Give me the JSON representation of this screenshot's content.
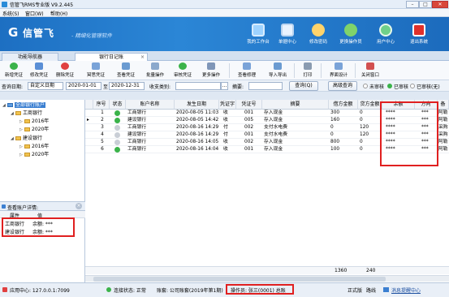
{
  "window": {
    "title": "信管飞RMS专业版 V9.2.445",
    "min": "–",
    "max": "□",
    "close": "✕"
  },
  "menu": [
    "系统(S)",
    "窗口(W)",
    "帮助(H)"
  ],
  "banner": {
    "logo_mark": "G",
    "logo_text": "信管飞",
    "slogan": "- 精细化管理软件",
    "nav": [
      {
        "label": "我的工作台",
        "icon": "monitor-icon",
        "color": "#9ed3ff"
      },
      {
        "label": "单据中心",
        "icon": "document-icon",
        "color": "#e9f3ff"
      },
      {
        "label": "修改密码",
        "icon": "key-user-icon",
        "color": "#ffd36b"
      },
      {
        "label": "更换操作员",
        "icon": "user-switch-icon",
        "color": "#7fd36b"
      },
      {
        "label": "用户中心",
        "icon": "globe-icon",
        "color": "#6fd08a"
      },
      {
        "label": "退出系统",
        "icon": "power-icon",
        "color": "#e0302a"
      }
    ]
  },
  "module_tabs": [
    {
      "label": "功能导航器",
      "active": false
    },
    {
      "label": "银行日记账",
      "active": true,
      "close": "×"
    }
  ],
  "toolbar": [
    {
      "label": "新增凭证",
      "icon": "add-icon",
      "color": "#3bb34a"
    },
    {
      "label": "修改凭证",
      "icon": "edit-icon",
      "color": "#5a8fd6"
    },
    {
      "label": "删除凭证",
      "icon": "delete-icon",
      "color": "#e04040"
    },
    {
      "label": "冥思凭证",
      "icon": "view-icon",
      "color": "#7aa3d8"
    },
    {
      "label": "查看凭证",
      "icon": "search-doc-icon",
      "color": "#6b9bd1"
    },
    {
      "label": "批量操作",
      "icon": "batch-icon",
      "color": "#8aa8cc"
    },
    {
      "label": "审核凭证",
      "icon": "check-icon",
      "color": "#3bb34a"
    },
    {
      "label": "更多操作",
      "icon": "more-icon",
      "color": "#7f96b8"
    },
    {
      "label": "查看修理",
      "icon": "repair-icon",
      "color": "#7aa3d8"
    },
    {
      "label": "导入导出",
      "icon": "import-export-icon",
      "color": "#6b9bd1"
    },
    {
      "label": "打印",
      "icon": "print-icon",
      "color": "#8a9bb0"
    },
    {
      "label": "界面设计",
      "icon": "design-icon",
      "color": "#7aa3d8"
    },
    {
      "label": "关闭窗口",
      "icon": "close-window-icon",
      "color": "#d25050"
    }
  ],
  "filter": {
    "date_label": "查询日期:",
    "date_mode": "自定义日期",
    "date_from": "2020-01-01",
    "to_label": "至",
    "date_to": "2020-12-31",
    "category_label": "收支类别:",
    "category_value": "",
    "summary_label": "摘要:",
    "summary_value": "",
    "query_button": "查询(Q)",
    "advanced_button": "高级查询",
    "unaudited": "未审核",
    "audited": "已审核",
    "audited_suffix": "已审核(无)"
  },
  "tree": [
    {
      "label": "全部银行账户",
      "level": 0,
      "toggle": "◢",
      "selected": true
    },
    {
      "label": "工商银行",
      "level": 1,
      "toggle": "◢"
    },
    {
      "label": "2016年",
      "level": 2,
      "toggle": "▷"
    },
    {
      "label": "2020年",
      "level": 2,
      "toggle": "▷"
    },
    {
      "label": "建设银行",
      "level": 1,
      "toggle": "◢"
    },
    {
      "label": "2016年",
      "level": 2,
      "toggle": "▷"
    },
    {
      "label": "2020年",
      "level": 2,
      "toggle": "▷"
    }
  ],
  "balance_panel": {
    "title": "查看账户详情:",
    "col_attr": "属性",
    "col_value": "值",
    "rows": [
      {
        "name": "工商银行",
        "value": "余额: ***"
      },
      {
        "name": "建设银行",
        "value": "余额: ***"
      }
    ]
  },
  "grid": {
    "columns": [
      "序号",
      "状态",
      "账户名称",
      "发生日期",
      "凭证字",
      "凭证号",
      "摘要",
      "借方金额",
      "贷方金额",
      "余额",
      "方向",
      "备"
    ],
    "rows": [
      {
        "no": "1",
        "status": "approved",
        "account": "工商银行",
        "date": "2020-08-05 11:03",
        "word": "收",
        "num": "001",
        "summary": "存入现金",
        "debit": "300",
        "credit": "0",
        "balance": "****",
        "dir": "***",
        "note": "阿勒"
      },
      {
        "no": "2",
        "status": "approved",
        "account": "建设银行",
        "date": "2020-08-05 14:42",
        "word": "收",
        "num": "005",
        "summary": "存入现金",
        "debit": "160",
        "credit": "0",
        "balance": "****",
        "dir": "***",
        "note": "阿勒"
      },
      {
        "no": "3",
        "status": "pending",
        "account": "工商银行",
        "date": "2020-08-16 14:29",
        "word": "付",
        "num": "002",
        "summary": "支付水电费",
        "debit": "0",
        "credit": "120",
        "balance": "****",
        "dir": "***",
        "note": "采购"
      },
      {
        "no": "4",
        "status": "pending",
        "account": "建设银行",
        "date": "2020-08-16 14:29",
        "word": "付",
        "num": "001",
        "summary": "支付水电费",
        "debit": "0",
        "credit": "120",
        "balance": "****",
        "dir": "***",
        "note": "采购"
      },
      {
        "no": "5",
        "status": "pending",
        "account": "工商银行",
        "date": "2020-08-16 14:05",
        "word": "收",
        "num": "002",
        "summary": "存入现金",
        "debit": "800",
        "credit": "0",
        "balance": "****",
        "dir": "***",
        "note": "阿勒"
      },
      {
        "no": "6",
        "status": "approved",
        "account": "工商银行",
        "date": "2020-08-16 14:04",
        "word": "收",
        "num": "001",
        "summary": "存入现金",
        "debit": "100",
        "credit": "0",
        "balance": "****",
        "dir": "***",
        "note": "阿勒"
      }
    ],
    "sum_debit": "1360",
    "sum_credit": "240"
  },
  "status": {
    "app_center": "应用中心: 127.0.0.1:7099",
    "conn": "连接状态: 正常",
    "book": "账套: 公司账套(2019年第1期)",
    "operator": "操作员: 张三(0001) 总账",
    "version": "正式版",
    "edition": "路线",
    "msg": "消息提醒中心"
  },
  "colors": {
    "approved": "#3bb34a",
    "pending": "#c9ced6",
    "highlight": "#e02020"
  }
}
